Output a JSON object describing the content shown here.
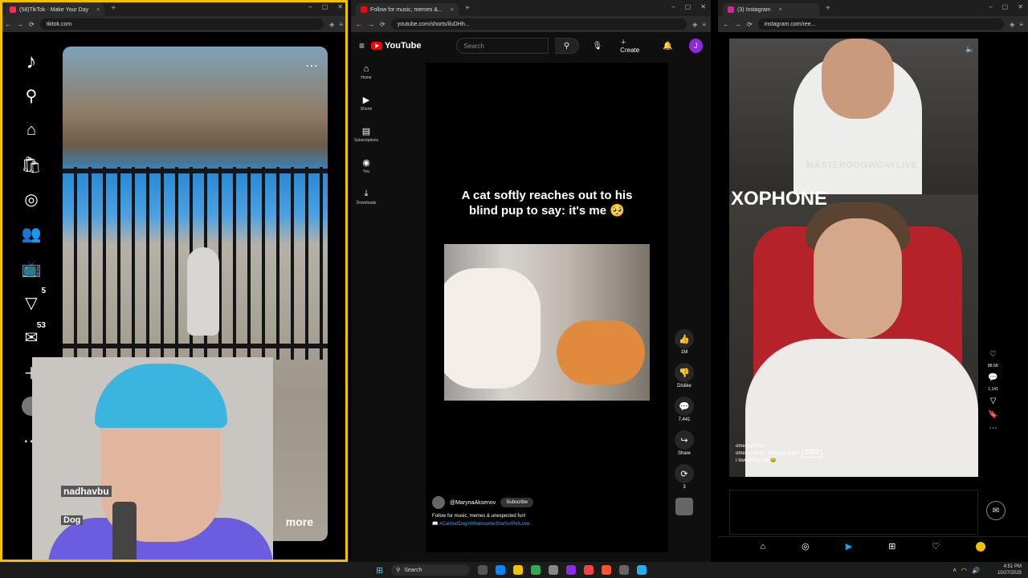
{
  "tiktok": {
    "tab_title": "(58)TikTok - Make Your Day",
    "url": "tiktok.com",
    "nav": [
      {
        "icon": "home-icon",
        "glyph": "⌂"
      },
      {
        "icon": "shop-icon",
        "glyph": "🛍"
      },
      {
        "icon": "explore-icon",
        "glyph": "◎"
      },
      {
        "icon": "following-icon",
        "glyph": "👥"
      },
      {
        "icon": "live-icon",
        "glyph": "📺"
      },
      {
        "icon": "activity-icon",
        "glyph": "▽",
        "badge": "5"
      },
      {
        "icon": "messages-icon",
        "glyph": "✉",
        "badge": "53"
      },
      {
        "icon": "upload-icon",
        "glyph": "＋"
      }
    ],
    "more_label": "more",
    "overlay_name": "nadhavbu",
    "overlay_name2": "Dog"
  },
  "youtube": {
    "tab_title": "Follow for music, memes &...",
    "url": "youtube.com/shorts/iluDHh...",
    "logo": "YouTube",
    "search_placeholder": "Search",
    "create_label": "Create",
    "avatar_letter": "J",
    "nav": [
      {
        "label": "Home",
        "glyph": "⌂"
      },
      {
        "label": "Shorts",
        "glyph": "▶"
      },
      {
        "label": "Subscriptions",
        "glyph": "▤"
      },
      {
        "label": "You",
        "glyph": "◉"
      },
      {
        "label": "Downloads",
        "glyph": "⤓"
      }
    ],
    "caption": "A cat softly reaches out to his blind pup to say: it's me 🥺",
    "channel": "@MarynaAksenov",
    "subscribe": "Subscribe",
    "description": "Follow for music, memes & unexpected fun!",
    "tags": "📖 #CatAndDog#WholesomeShorts#PetLove",
    "actions": [
      {
        "name": "like-button",
        "glyph": "👍",
        "label": "1M"
      },
      {
        "name": "dislike-button",
        "glyph": "👎",
        "label": "Dislike"
      },
      {
        "name": "comments-button",
        "glyph": "💬",
        "label": "7,441"
      },
      {
        "name": "share-button",
        "glyph": "↪",
        "label": "Share"
      },
      {
        "name": "remix-button",
        "glyph": "⟳",
        "label": "3"
      }
    ]
  },
  "instagram": {
    "tab_title": "(3) Instagram",
    "url": "instagram.com/ree...",
    "watermark": "MASTEROOGWGAYLIVE",
    "big_text": "XOPHONE",
    "username": "omersastimm",
    "audio": "omersastimm · Original audio",
    "follow": "Follow",
    "caption": "I love doing this 😂",
    "likes": "88.5K",
    "comments": "1,141"
  },
  "taskbar": {
    "search": "Search",
    "time": "4:51 PM",
    "date": "10/27/2025"
  }
}
